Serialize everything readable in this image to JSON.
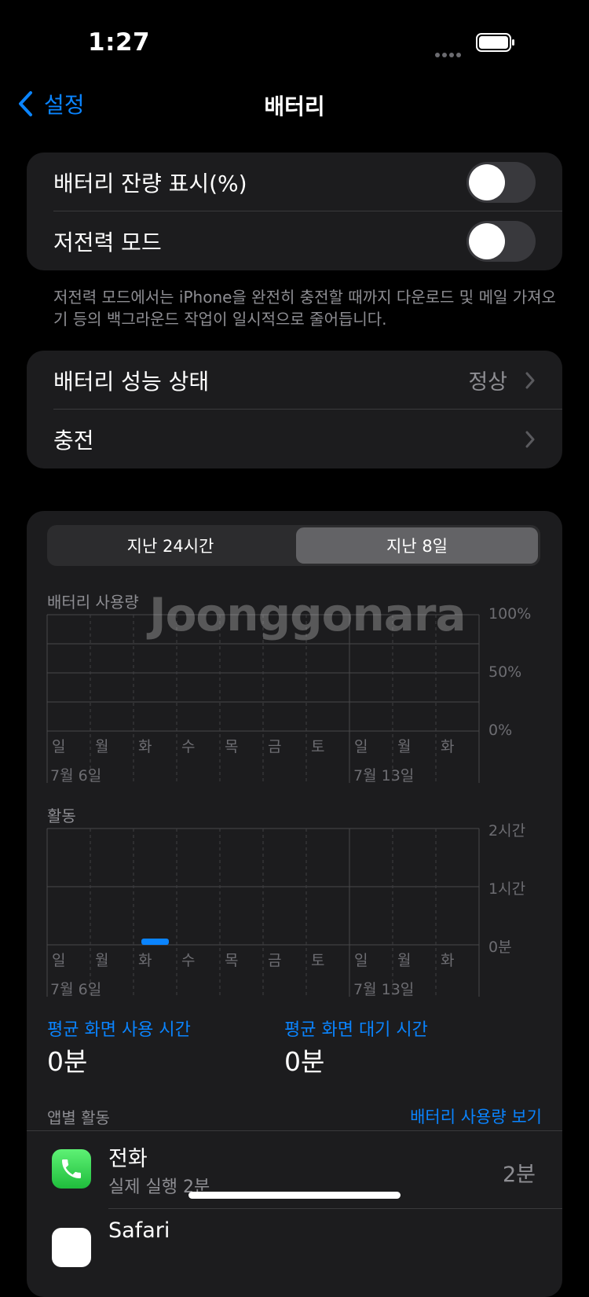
{
  "status": {
    "time": "1:27"
  },
  "nav": {
    "back_label": "설정",
    "title": "배터리"
  },
  "group1": {
    "percent_label": "배터리 잔량 표시(%)",
    "low_power_label": "저전력 모드",
    "percent_on": false,
    "low_power_on": false
  },
  "footnote": "저전력 모드에서는 iPhone을 완전히 충전할 때까지 다운로드 및 메일 가져오기 등의 백그라운드 작업이 일시적으로 줄어듭니다.",
  "group2": {
    "health_label": "배터리 성능 상태",
    "health_value": "정상",
    "charging_label": "충전"
  },
  "segment": {
    "left": "지난 24시간",
    "right": "지난 8일",
    "selected": "right"
  },
  "watermark": "Joonggonara",
  "usage_chart": {
    "title": "배터리 사용량",
    "y_labels": [
      "100%",
      "50%",
      "0%"
    ],
    "days": [
      "일",
      "월",
      "화",
      "수",
      "목",
      "금",
      "토",
      "일",
      "월",
      "화"
    ],
    "date1": "7월 6일",
    "date2": "7월 13일"
  },
  "activity_chart": {
    "title": "활동",
    "y_labels": [
      "2시간",
      "1시간",
      "0분"
    ],
    "days": [
      "일",
      "월",
      "화",
      "수",
      "목",
      "금",
      "토",
      "일",
      "월",
      "화"
    ],
    "date1": "7월 6일",
    "date2": "7월 13일"
  },
  "chart_data": {
    "type": "bar",
    "categories": [
      "일",
      "월",
      "화",
      "수",
      "목",
      "금",
      "토",
      "일",
      "월",
      "화"
    ],
    "series": [
      {
        "values": [
          0,
          0,
          2,
          0,
          0,
          0,
          0,
          0,
          0,
          0
        ]
      }
    ],
    "ylabel": "",
    "ylim": [
      0,
      120
    ],
    "y_unit": "분"
  },
  "stats": {
    "screen_on_title": "평균 화면 사용 시간",
    "screen_on_value": "0분",
    "screen_off_title": "평균 화면 대기 시간",
    "screen_off_value": "0분"
  },
  "apps": {
    "header": "앱별 활동",
    "show_usage": "배터리 사용량 보기",
    "items": [
      {
        "name": "전화",
        "sub": "실제 실행 2분",
        "value": "2분",
        "icon": "phone-icon"
      },
      {
        "name": "Safari",
        "sub": "",
        "value": "",
        "icon": "safari-icon"
      }
    ]
  },
  "colors": {
    "accent": "#0a84ff",
    "bar": "#0a84ff"
  }
}
